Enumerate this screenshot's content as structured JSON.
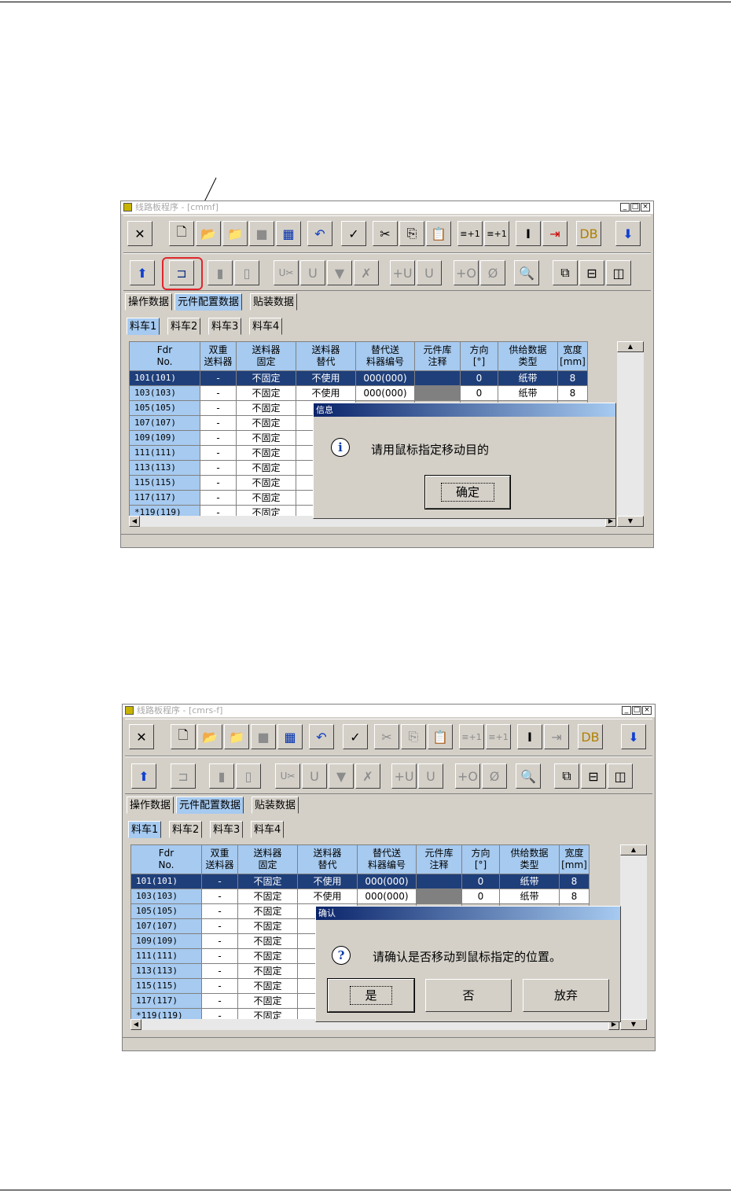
{
  "screen1": {
    "title": "线路板程序 - [cmmf]",
    "tabs": [
      "操作数据",
      "元件配置数据",
      "贴装数据"
    ],
    "cart_tabs": [
      "料车1",
      "料车2",
      "料车3",
      "料车4"
    ],
    "headers": [
      [
        "Fdr",
        "No."
      ],
      [
        "双重",
        "送料器"
      ],
      [
        "送料器",
        "固定"
      ],
      [
        "送料器",
        "替代"
      ],
      [
        "替代送",
        "料器编号"
      ],
      [
        "元件库",
        "注释"
      ],
      [
        "方向",
        "[°]"
      ],
      [
        "供给数据",
        "类型"
      ],
      [
        "宽度",
        "[mm]"
      ]
    ],
    "rows": [
      [
        "101(101)",
        "-",
        "不固定",
        "不使用",
        "000(000)",
        "",
        "0",
        "纸带",
        "8"
      ],
      [
        "103(103)",
        "-",
        "不固定",
        "不使用",
        "000(000)",
        "",
        "0",
        "纸带",
        "8"
      ],
      [
        "105(105)",
        "-",
        "不固定",
        "不"
      ],
      [
        "107(107)",
        "-",
        "不固定",
        "不"
      ],
      [
        "109(109)",
        "-",
        "不固定",
        "不"
      ],
      [
        "111(111)",
        "-",
        "不固定",
        "不"
      ],
      [
        "113(113)",
        "-",
        "不固定",
        "不"
      ],
      [
        "115(115)",
        "-",
        "不固定",
        "不"
      ],
      [
        "117(117)",
        "-",
        "不固定",
        "不"
      ],
      [
        "*119(119)",
        "-",
        "不固定",
        "不"
      ]
    ],
    "dialog": {
      "title": "信息",
      "message": "请用鼠标指定移动目的",
      "ok": "确定"
    }
  },
  "screen2": {
    "title": "线路板程序 - [cmrs-f]",
    "tabs": [
      "操作数据",
      "元件配置数据",
      "贴装数据"
    ],
    "cart_tabs": [
      "料车1",
      "料车2",
      "料车3",
      "料车4"
    ],
    "headers": [
      [
        "Fdr",
        "No."
      ],
      [
        "双重",
        "送料器"
      ],
      [
        "送料器",
        "固定"
      ],
      [
        "送料器",
        "替代"
      ],
      [
        "替代送",
        "料器编号"
      ],
      [
        "元件库",
        "注释"
      ],
      [
        "方向",
        "[°]"
      ],
      [
        "供给数据",
        "类型"
      ],
      [
        "宽度",
        "[mm]"
      ]
    ],
    "rows": [
      [
        "101(101)",
        "-",
        "不固定",
        "不使用",
        "000(000)",
        "",
        "0",
        "纸带",
        "8"
      ],
      [
        "103(103)",
        "-",
        "不固定",
        "不使用",
        "000(000)",
        "",
        "0",
        "纸带",
        "8"
      ],
      [
        "105(105)",
        "-",
        "不固定",
        "不"
      ],
      [
        "107(107)",
        "-",
        "不固定",
        "不"
      ],
      [
        "109(109)",
        "-",
        "不固定",
        "不"
      ],
      [
        "111(111)",
        "-",
        "不固定",
        "不"
      ],
      [
        "113(113)",
        "-",
        "不固定",
        "不"
      ],
      [
        "115(115)",
        "-",
        "不固定",
        "不"
      ],
      [
        "117(117)",
        "-",
        "不固定",
        "不"
      ],
      [
        "*119(119)",
        "-",
        "不固定",
        "不"
      ]
    ],
    "dialog": {
      "title": "确认",
      "message": "请确认是否移动到鼠标指定的位置。",
      "yes": "是",
      "no": "否",
      "cancel": "放弃"
    }
  },
  "icons": {
    "row1": [
      "close-icon",
      "new-file-icon",
      "open-folder-icon",
      "open-folder-alt-icon",
      "gray-box-icon",
      "save-icon",
      "undo-icon",
      "check-icon",
      "cut-icon",
      "copy-icon",
      "paste-icon",
      "plus-one-icon",
      "plus-one-alt-icon",
      "cursor-icon",
      "move-right-icon",
      "db-icon",
      "arrow-down-icon"
    ],
    "row2": [
      "arrow-up-icon",
      "feeder-move-icon",
      "dual-icon",
      "feeder-gray-icon",
      "ux-cut-icon",
      "ux-icon",
      "nozzle-icon",
      "x-icon",
      "plus-u-icon",
      "u-arrow-icon",
      "plus-o-icon",
      "zero-icon",
      "search-icon",
      "window-cascade-icon",
      "window-hsplit-icon",
      "window-vsplit-icon"
    ]
  },
  "colors": {
    "selected_row": "#1f3f7a",
    "header": "#a6caf0",
    "highlight": "#e0262c"
  }
}
